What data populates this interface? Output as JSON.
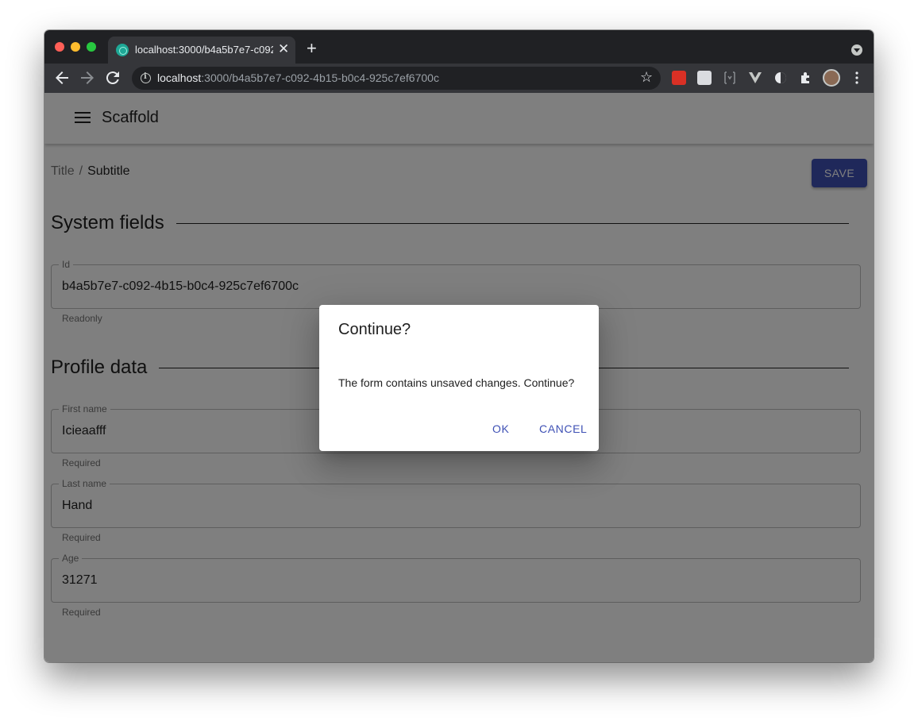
{
  "browser": {
    "tab_title": "localhost:3000/b4a5b7e7-c092-4b15-b0c4-925c7ef6700c",
    "url_host": "localhost",
    "url_rest": ":3000/b4a5b7e7-c092-4b15-b0c4-925c7ef6700c"
  },
  "appbar": {
    "title": "Scaffold"
  },
  "breadcrumb": {
    "items": [
      "Title",
      "Subtitle"
    ],
    "separator": "/"
  },
  "toolbar": {
    "save_label": "SAVE"
  },
  "sections": [
    {
      "title": "System fields",
      "fields": [
        {
          "label": "Id",
          "value": "b4a5b7e7-c092-4b15-b0c4-925c7ef6700c",
          "helper": "Readonly"
        }
      ]
    },
    {
      "title": "Profile data",
      "fields": [
        {
          "label": "First name",
          "value": "Icieaafff",
          "helper": "Required"
        },
        {
          "label": "Last name",
          "value": "Hand",
          "helper": "Required"
        },
        {
          "label": "Age",
          "value": "31271",
          "helper": "Required"
        }
      ]
    }
  ],
  "dialog": {
    "title": "Continue?",
    "message": "The form contains unsaved changes. Continue?",
    "ok_label": "OK",
    "cancel_label": "CANCEL"
  },
  "colors": {
    "primary": "#3f51b5",
    "tab_strip": "#202124",
    "toolbar": "#35363a"
  }
}
